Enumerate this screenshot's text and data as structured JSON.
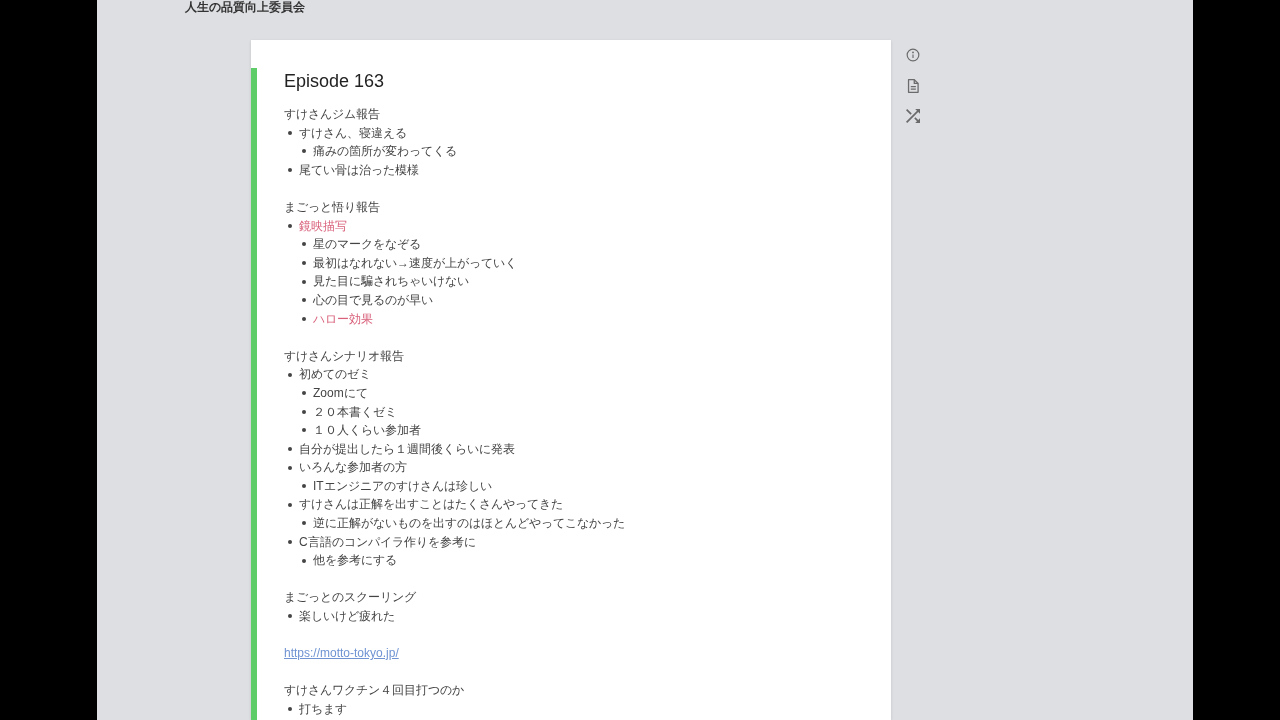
{
  "header": {
    "title": "人生の品質向上委員会"
  },
  "note": {
    "title": "Episode 163",
    "blocks": [
      {
        "kind": "section",
        "heading": "すけさんジム報告",
        "items": [
          {
            "text": "すけさん、寝違える",
            "highlighted": false,
            "children": [
              {
                "text": "痛みの箇所が変わってくる",
                "highlighted": false
              }
            ]
          },
          {
            "text": "尾てい骨は治った模様",
            "highlighted": false
          }
        ]
      },
      {
        "kind": "section",
        "heading": "まごっと悟り報告",
        "items": [
          {
            "text": "鏡映描写",
            "highlighted": true,
            "children": [
              {
                "text": "星のマークをなぞる",
                "highlighted": false
              },
              {
                "text": "最初はなれない→速度が上がっていく",
                "highlighted": false
              },
              {
                "text": "見た目に騙されちゃいけない",
                "highlighted": false
              },
              {
                "text": "心の目で見るのが早い",
                "highlighted": false
              },
              {
                "text": "ハロー効果",
                "highlighted": true
              }
            ]
          }
        ]
      },
      {
        "kind": "section",
        "heading": "すけさんシナリオ報告",
        "items": [
          {
            "text": "初めてのゼミ",
            "highlighted": false,
            "children": [
              {
                "text": "Zoomにて",
                "highlighted": false
              },
              {
                "text": "２０本書くゼミ",
                "highlighted": false
              },
              {
                "text": "１０人くらい参加者",
                "highlighted": false
              }
            ]
          },
          {
            "text": "自分が提出したら１週間後くらいに発表",
            "highlighted": false
          },
          {
            "text": "いろんな参加者の方",
            "highlighted": false,
            "children": [
              {
                "text": "ITエンジニアのすけさんは珍しい",
                "highlighted": false
              }
            ]
          },
          {
            "text": "すけさんは正解を出すことはたくさんやってきた",
            "highlighted": false,
            "children": [
              {
                "text": "逆に正解がないものを出すのはほとんどやってこなかった",
                "highlighted": false
              }
            ]
          },
          {
            "text": "C言語のコンパイラ作りを参考に",
            "highlighted": false,
            "children": [
              {
                "text": "他を参考にする",
                "highlighted": false
              }
            ]
          }
        ]
      },
      {
        "kind": "section",
        "heading": "まごっとのスクーリング",
        "items": [
          {
            "text": "楽しいけど疲れた",
            "highlighted": false
          }
        ]
      },
      {
        "kind": "link",
        "text": "https://motto-tokyo.jp/"
      },
      {
        "kind": "section",
        "heading": "すけさんワクチン４回目打つのか",
        "items": [
          {
            "text": "打ちます",
            "highlighted": false
          }
        ]
      }
    ]
  }
}
